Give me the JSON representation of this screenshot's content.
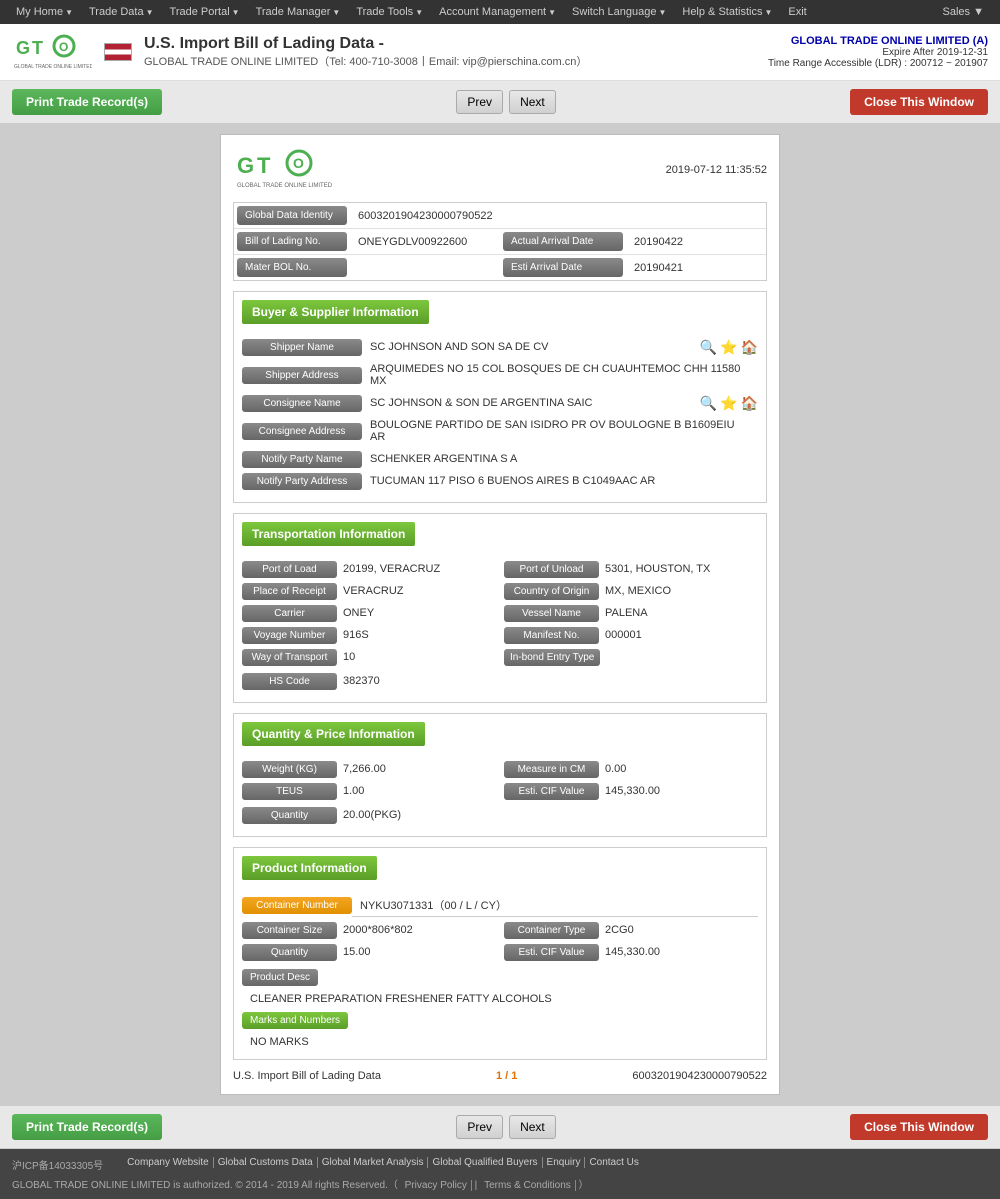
{
  "topnav": {
    "items": [
      {
        "label": "My Home",
        "arrow": true
      },
      {
        "label": "Trade Data",
        "arrow": true
      },
      {
        "label": "Trade Portal",
        "arrow": true
      },
      {
        "label": "Trade Manager",
        "arrow": true
      },
      {
        "label": "Trade Tools",
        "arrow": true
      },
      {
        "label": "Account Management",
        "arrow": true
      },
      {
        "label": "Switch Language",
        "arrow": true
      },
      {
        "label": "Help & Statistics",
        "arrow": true
      },
      {
        "label": "Exit",
        "arrow": false
      }
    ],
    "sales": "Sales"
  },
  "header": {
    "title": "U.S. Import Bill of Lading Data  -",
    "subtitle": "GLOBAL TRADE ONLINE LIMITED（Tel: 400-710-3008丨Email: vip@pierschina.com.cn）",
    "company": "GLOBAL TRADE ONLINE LIMITED (A)",
    "expire": "Expire After 2019-12-31",
    "ldr": "Time Range Accessible (LDR) : 200712 ~ 201907"
  },
  "toolbar": {
    "print_label": "Print Trade Record(s)",
    "prev_label": "Prev",
    "next_label": "Next",
    "close_label": "Close This Window"
  },
  "record": {
    "date": "2019-07-12 11:35:52",
    "global_data_identity_label": "Global Data Identity",
    "global_data_identity": "6003201904230000790522",
    "bill_of_lading_label": "Bill of Lading No.",
    "bill_of_lading": "ONEYGDLV00922600",
    "actual_arrival_label": "Actual Arrival Date",
    "actual_arrival": "20190422",
    "master_bol_label": "Mater BOL No.",
    "esti_arrival_label": "Esti Arrival Date",
    "esti_arrival": "20190421"
  },
  "buyer_supplier": {
    "section_title": "Buyer & Supplier Information",
    "shipper_name_label": "Shipper Name",
    "shipper_name": "SC JOHNSON AND SON SA DE CV",
    "shipper_address_label": "Shipper Address",
    "shipper_address": "ARQUIMEDES NO 15 COL BOSQUES DE CH CUAUHTEMOC CHH 11580 MX",
    "consignee_name_label": "Consignee Name",
    "consignee_name": "SC JOHNSON & SON DE ARGENTINA SAIC",
    "consignee_address_label": "Consignee Address",
    "consignee_address": "BOULOGNE PARTIDO DE SAN ISIDRO PR OV BOULOGNE B B1609EIU AR",
    "notify_party_name_label": "Notify Party Name",
    "notify_party_name": "SCHENKER ARGENTINA S A",
    "notify_party_address_label": "Notify Party Address",
    "notify_party_address": "TUCUMAN 117 PISO 6 BUENOS AIRES B C1049AAC AR"
  },
  "transportation": {
    "section_title": "Transportation Information",
    "port_of_load_label": "Port of Load",
    "port_of_load": "20199, VERACRUZ",
    "port_of_unload_label": "Port of Unload",
    "port_of_unload": "5301, HOUSTON, TX",
    "place_of_receipt_label": "Place of Receipt",
    "place_of_receipt": "VERACRUZ",
    "country_of_origin_label": "Country of Origin",
    "country_of_origin": "MX, MEXICO",
    "carrier_label": "Carrier",
    "carrier": "ONEY",
    "vessel_name_label": "Vessel Name",
    "vessel_name": "PALENA",
    "voyage_number_label": "Voyage Number",
    "voyage_number": "916S",
    "manifest_no_label": "Manifest No.",
    "manifest_no": "000001",
    "way_of_transport_label": "Way of Transport",
    "way_of_transport": "10",
    "in_bond_entry_label": "In-bond Entry Type",
    "in_bond_entry": "",
    "hs_code_label": "HS Code",
    "hs_code": "382370"
  },
  "quantity_price": {
    "section_title": "Quantity & Price Information",
    "weight_label": "Weight (KG)",
    "weight": "7,266.00",
    "measure_cm_label": "Measure in CM",
    "measure_cm": "0.00",
    "teus_label": "TEUS",
    "teus": "1.00",
    "esti_cif_label": "Esti. CIF Value",
    "esti_cif": "145,330.00",
    "quantity_label": "Quantity",
    "quantity": "20.00(PKG)"
  },
  "product": {
    "section_title": "Product Information",
    "container_number_label": "Container Number",
    "container_number": "NYKU3071331（00 / L / CY）",
    "container_size_label": "Container Size",
    "container_size": "2000*806*802",
    "container_type_label": "Container Type",
    "container_type": "2CG0",
    "quantity_label": "Quantity",
    "quantity": "15.00",
    "esti_cif_label": "Esti. CIF Value",
    "esti_cif": "145,330.00",
    "product_desc_label": "Product Desc",
    "product_desc": "CLEANER PREPARATION FRESHENER FATTY ALCOHOLS",
    "marks_and_numbers_label": "Marks and Numbers",
    "marks_and_numbers": "NO MARKS"
  },
  "page_info": {
    "record_label": "U.S. Import Bill of Lading Data",
    "page": "1 / 1",
    "record_id": "6003201904230000790522"
  },
  "footer": {
    "icp": "沪ICP备14033305号",
    "links": [
      "Company Website",
      "Global Customs Data",
      "Global Market Analysis",
      "Global Qualified Buyers",
      "Enquiry",
      "Contact Us"
    ],
    "copyright": "GLOBAL TRADE ONLINE LIMITED is authorized. © 2014 - 2019 All rights Reserved.（",
    "privacy": "Privacy Policy",
    "terms": "Terms & Conditions",
    "copy_end": "）"
  }
}
